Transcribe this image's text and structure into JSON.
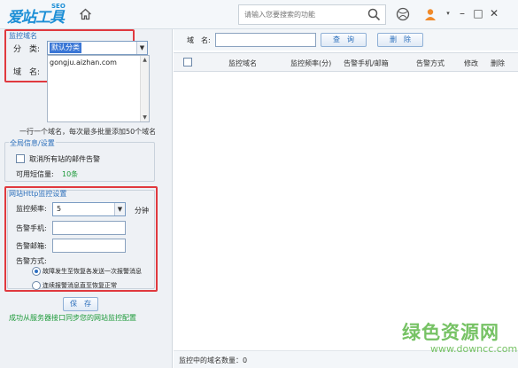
{
  "app": {
    "logo_text": "爱站工具包",
    "logo_sup": "SEO",
    "search_placeholder": "请输入您要搜索的功能"
  },
  "left": {
    "monitor_domain": {
      "title": "监控域名",
      "category_label": "分　类:",
      "category_value": "默认分类",
      "domain_label": "域　名:",
      "domain_value": "gongju.aizhan.com",
      "hint": "一行一个域名，每次最多批量添加50个域名"
    },
    "global": {
      "title": "全局信息/设置",
      "cancel_all_alerts": "取消所有站的邮件告警",
      "sms_label": "可用短信量:",
      "sms_value": "10条"
    },
    "http": {
      "title": "网站Http监控设置",
      "freq_label": "监控频率:",
      "freq_value": "5",
      "freq_unit": "分钟",
      "phone_label": "告警手机:",
      "email_label": "告警邮箱:",
      "method_label": "告警方式:",
      "method_options": [
        "故障发生至恢复各发送一次报警消息",
        "连续报警消息直至恢复正常"
      ]
    },
    "save_label": "保　存",
    "status_text": "成功从服务器接口同步您的网站监控配置"
  },
  "right": {
    "filter_label": "域　名:",
    "query_label": "查　询",
    "delete_label": "删　除",
    "columns": [
      "监控域名",
      "监控频率(分)",
      "告警手机/邮箱",
      "告警方式",
      "修改",
      "删除"
    ],
    "footer": "监控中的域名数量：0"
  },
  "watermark": {
    "cn": "绿色资源网",
    "en": "www.downcc.com"
  },
  "colors": {
    "accent": "#2a6ebb",
    "highlight_box": "#e0393e",
    "success": "#1d9a39"
  }
}
